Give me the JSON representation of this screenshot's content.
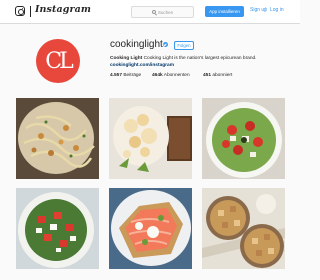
{
  "header": {
    "wordmark": "Instagram",
    "search_placeholder": "Suchen",
    "install_label": "App installieren",
    "signup_label": "Sign up",
    "separator": "|",
    "login_label": "Log in"
  },
  "profile": {
    "avatar_text": "CL",
    "username": "cookinglight",
    "verified": true,
    "follow_label": "Folgen",
    "bio_name": "Cooking Light",
    "bio_text": " Cooking Light is the nation's largest epicurean brand.",
    "website": "cookinglight.com/instagram",
    "stats": [
      {
        "value": "4.557",
        "label": " Beiträge"
      },
      {
        "value": "464k",
        "label": " Abonnenten"
      },
      {
        "value": "451",
        "label": " abonniert"
      }
    ]
  },
  "posts": [
    {
      "name": "pasta-with-chickpeas"
    },
    {
      "name": "cauliflower-and-toast"
    },
    {
      "name": "tomato-salad-bowl"
    },
    {
      "name": "feta-salad-bowl"
    },
    {
      "name": "salmon-toast"
    },
    {
      "name": "granola-bowls"
    }
  ],
  "colors": {
    "accent": "#3897f0",
    "avatar": "#e8473c",
    "link": "#003569"
  }
}
